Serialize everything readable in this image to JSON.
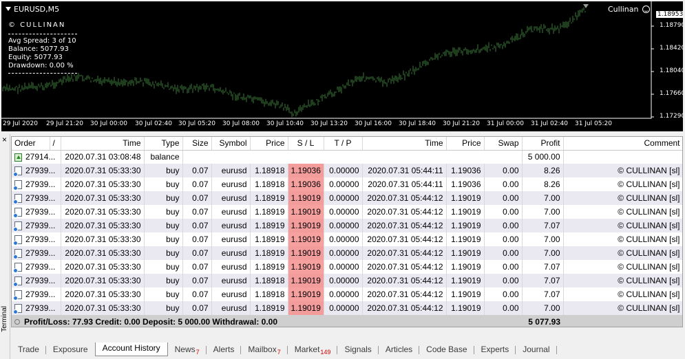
{
  "chart": {
    "title": "EURUSD,M5",
    "ea_name": "Cullinan",
    "brand": "© CULLINAN",
    "info": [
      {
        "label": "Avg Spread:",
        "value": "3 of 10"
      },
      {
        "label": "Balance:",
        "value": "5077.93"
      },
      {
        "label": "Equity:",
        "value": "5077.93"
      },
      {
        "label": "Drawdown:",
        "value": "0.00 %"
      }
    ],
    "current_price": "1.18953",
    "price_scale": [
      "1.18790",
      "1.18420",
      "1.18040",
      "1.17660",
      "1.17290"
    ],
    "time_scale": [
      "29 Jul 2020",
      "29 Jul 21:20",
      "30 Jul 00:00",
      "30 Jul 02:40",
      "30 Jul 05:20",
      "30 Jul 08:00",
      "30 Jul 10:40",
      "30 Jul 13:20",
      "30 Jul 16:00",
      "30 Jul 18:40",
      "30 Jul 21:20",
      "31 Jul 00:00",
      "31 Jul 02:40",
      "31 Jul 05:20"
    ],
    "colors": {
      "background": "#000000",
      "bars": "#3a7a3a",
      "text": "#ffffff"
    }
  },
  "terminal": {
    "side_label": "Terminal",
    "close_glyph": "×",
    "columns": [
      "Order",
      "/",
      "Time",
      "Type",
      "Size",
      "Symbol",
      "Price",
      "S / L",
      "T / P",
      "Time",
      "Price",
      "Swap",
      "Profit",
      "Comment"
    ],
    "balance_row": {
      "order": "27914...",
      "time": "2020.07.31 03:08:48",
      "type": "balance",
      "profit": "5 000.00"
    },
    "rows": [
      {
        "order": "27939...",
        "open_time": "2020.07.31 05:33:30",
        "type": "buy",
        "size": "0.07",
        "symbol": "eurusd",
        "price": "1.18918",
        "sl": "1.19036",
        "tp": "0.00000",
        "close_time": "2020.07.31 05:44:11",
        "close_price": "1.19036",
        "swap": "0.00",
        "profit": "8.26",
        "comment": "© CULLINAN [sl]"
      },
      {
        "order": "27939...",
        "open_time": "2020.07.31 05:33:30",
        "type": "buy",
        "size": "0.07",
        "symbol": "eurusd",
        "price": "1.18918",
        "sl": "1.19036",
        "tp": "0.00000",
        "close_time": "2020.07.31 05:44:11",
        "close_price": "1.19036",
        "swap": "0.00",
        "profit": "8.26",
        "comment": "© CULLINAN [sl]"
      },
      {
        "order": "27939...",
        "open_time": "2020.07.31 05:33:30",
        "type": "buy",
        "size": "0.07",
        "symbol": "eurusd",
        "price": "1.18919",
        "sl": "1.19019",
        "tp": "0.00000",
        "close_time": "2020.07.31 05:44:12",
        "close_price": "1.19019",
        "swap": "0.00",
        "profit": "7.00",
        "comment": "© CULLINAN [sl]"
      },
      {
        "order": "27939...",
        "open_time": "2020.07.31 05:33:30",
        "type": "buy",
        "size": "0.07",
        "symbol": "eurusd",
        "price": "1.18919",
        "sl": "1.19019",
        "tp": "0.00000",
        "close_time": "2020.07.31 05:44:12",
        "close_price": "1.19019",
        "swap": "0.00",
        "profit": "7.00",
        "comment": "© CULLINAN [sl]"
      },
      {
        "order": "27939...",
        "open_time": "2020.07.31 05:33:30",
        "type": "buy",
        "size": "0.07",
        "symbol": "eurusd",
        "price": "1.18919",
        "sl": "1.19019",
        "tp": "0.00000",
        "close_time": "2020.07.31 05:44:12",
        "close_price": "1.19019",
        "swap": "0.00",
        "profit": "7.07",
        "comment": "© CULLINAN [sl]"
      },
      {
        "order": "27939...",
        "open_time": "2020.07.31 05:33:30",
        "type": "buy",
        "size": "0.07",
        "symbol": "eurusd",
        "price": "1.18919",
        "sl": "1.19019",
        "tp": "0.00000",
        "close_time": "2020.07.31 05:44:12",
        "close_price": "1.19019",
        "swap": "0.00",
        "profit": "7.00",
        "comment": "© CULLINAN [sl]"
      },
      {
        "order": "27939...",
        "open_time": "2020.07.31 05:33:30",
        "type": "buy",
        "size": "0.07",
        "symbol": "eurusd",
        "price": "1.18919",
        "sl": "1.19019",
        "tp": "0.00000",
        "close_time": "2020.07.31 05:44:12",
        "close_price": "1.19019",
        "swap": "0.00",
        "profit": "7.00",
        "comment": "© CULLINAN [sl]"
      },
      {
        "order": "27939...",
        "open_time": "2020.07.31 05:33:30",
        "type": "buy",
        "size": "0.07",
        "symbol": "eurusd",
        "price": "1.18919",
        "sl": "1.19019",
        "tp": "0.00000",
        "close_time": "2020.07.31 05:44:12",
        "close_price": "1.19019",
        "swap": "0.00",
        "profit": "7.07",
        "comment": "© CULLINAN [sl]"
      },
      {
        "order": "27939...",
        "open_time": "2020.07.31 05:33:30",
        "type": "buy",
        "size": "0.07",
        "symbol": "eurusd",
        "price": "1.18918",
        "sl": "1.19019",
        "tp": "0.00000",
        "close_time": "2020.07.31 05:44:12",
        "close_price": "1.19019",
        "swap": "0.00",
        "profit": "7.07",
        "comment": "© CULLINAN [sl]"
      },
      {
        "order": "27939...",
        "open_time": "2020.07.31 05:33:30",
        "type": "buy",
        "size": "0.07",
        "symbol": "eurusd",
        "price": "1.18918",
        "sl": "1.19019",
        "tp": "0.00000",
        "close_time": "2020.07.31 05:44:12",
        "close_price": "1.19019",
        "swap": "0.00",
        "profit": "7.07",
        "comment": "© CULLINAN [sl]"
      },
      {
        "order": "27939...",
        "open_time": "2020.07.31 05:33:30",
        "type": "buy",
        "size": "0.07",
        "symbol": "eurusd",
        "price": "1.18919",
        "sl": "1.19019",
        "tp": "0.00000",
        "close_time": "2020.07.31 05:44:12",
        "close_price": "1.19019",
        "swap": "0.00",
        "profit": "7.00",
        "comment": "© CULLINAN [sl]"
      }
    ],
    "summary": {
      "text": "Profit/Loss: 77.93  Credit: 0.00  Deposit: 5 000.00  Withdrawal: 0.00",
      "total": "5 077.93"
    },
    "tabs": [
      {
        "label": "Trade",
        "badge": ""
      },
      {
        "label": "Exposure",
        "badge": ""
      },
      {
        "label": "Account History",
        "badge": "",
        "active": true
      },
      {
        "label": "News",
        "badge": "7"
      },
      {
        "label": "Alerts",
        "badge": ""
      },
      {
        "label": "Mailbox",
        "badge": "7"
      },
      {
        "label": "Market",
        "badge": "149"
      },
      {
        "label": "Signals",
        "badge": ""
      },
      {
        "label": "Articles",
        "badge": ""
      },
      {
        "label": "Code Base",
        "badge": ""
      },
      {
        "label": "Experts",
        "badge": ""
      },
      {
        "label": "Journal",
        "badge": ""
      }
    ]
  }
}
